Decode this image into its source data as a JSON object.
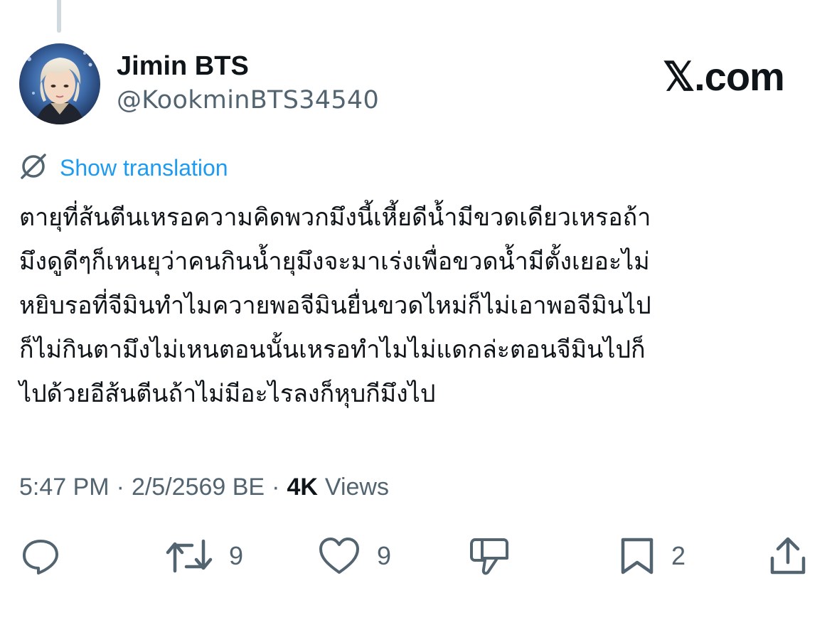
{
  "tweet": {
    "display_name": "Jimin BTS",
    "handle": "@KookminBTS34540",
    "brand": "𝕏.com",
    "translation_link": "Show translation",
    "text_lines": [
      "ตายุที่ส้นตีนเหรอความคิดพวกมึงนี้เหี้ยดีน้ำมีขวดเดียวเหรอถ้า",
      "มึงดูดีๆก็เหนยุว่าคนกินน้ำยุมึงจะมาเร่งเพื่อขวดน้ำมีตั้งเยอะไม่",
      "หยิบรอที่จีมินทำไมควายพอจีมินยื่นขวดไหม่ก็ไม่เอาพอจีมินไป",
      "ก็ไม่กินตามึงไม่เหนตอนนั้นเหรอทำไมไม่แดกล่ะตอนจีมินไปก็",
      "ไปด้วยอีส้นตีนถ้าไม่มีอะไรลงก็หุบกีมึงไป"
    ],
    "time": "5:47 PM",
    "date": "2/5/2569 BE",
    "separator": "·",
    "views_count": "4K",
    "views_label": "Views"
  },
  "actions": {
    "reply_icon": "reply-icon",
    "retweet_icon": "retweet-icon",
    "retweet_count": "9",
    "like_icon": "heart-icon",
    "like_count": "9",
    "dislike_icon": "thumbs-down-icon",
    "bookmark_icon": "bookmark-icon",
    "bookmark_count": "2",
    "share_icon": "share-icon"
  },
  "colors": {
    "text_primary": "#0f1419",
    "text_secondary": "#536471",
    "link": "#1d9bf0",
    "thread_line": "#cfd9de"
  }
}
